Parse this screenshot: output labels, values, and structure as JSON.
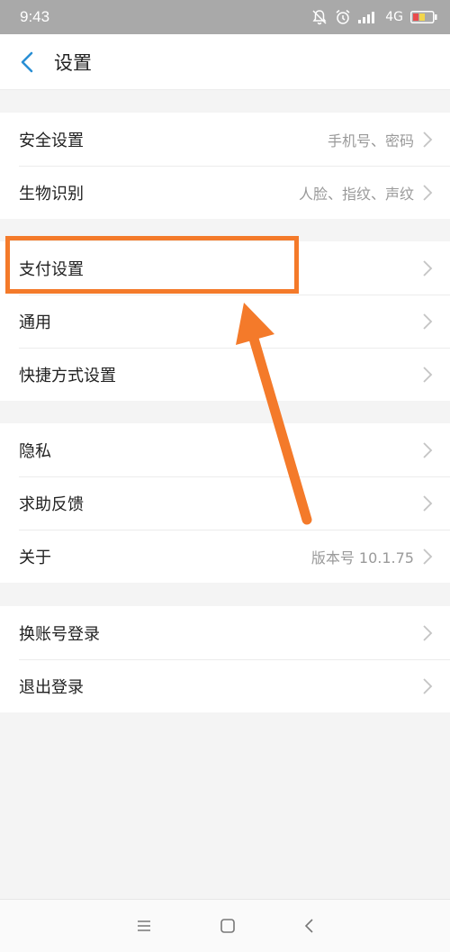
{
  "status_bar": {
    "time": "9:43",
    "network": "4G",
    "icons": [
      "mute-bell-icon",
      "alarm-icon",
      "signal-icon",
      "battery-icon"
    ]
  },
  "header": {
    "back_icon": "chevron-left-icon",
    "title": "设置",
    "accent_color": "#2a8fd4"
  },
  "groups": [
    {
      "rows": [
        {
          "label": "安全设置",
          "value": "手机号、密码"
        },
        {
          "label": "生物识别",
          "value": "人脸、指纹、声纹"
        }
      ]
    },
    {
      "rows": [
        {
          "label": "支付设置",
          "value": ""
        },
        {
          "label": "通用",
          "value": ""
        },
        {
          "label": "快捷方式设置",
          "value": ""
        }
      ]
    },
    {
      "rows": [
        {
          "label": "隐私",
          "value": ""
        },
        {
          "label": "求助反馈",
          "value": ""
        },
        {
          "label": "关于",
          "value": "版本号 10.1.75"
        }
      ]
    },
    {
      "rows": [
        {
          "label": "换账号登录",
          "value": ""
        },
        {
          "label": "退出登录",
          "value": ""
        }
      ]
    }
  ],
  "annotation": {
    "color": "#f47a2a",
    "target": "支付设置"
  },
  "nav_bar": {
    "icons": [
      "menu-icon",
      "home-icon",
      "back-icon"
    ]
  }
}
